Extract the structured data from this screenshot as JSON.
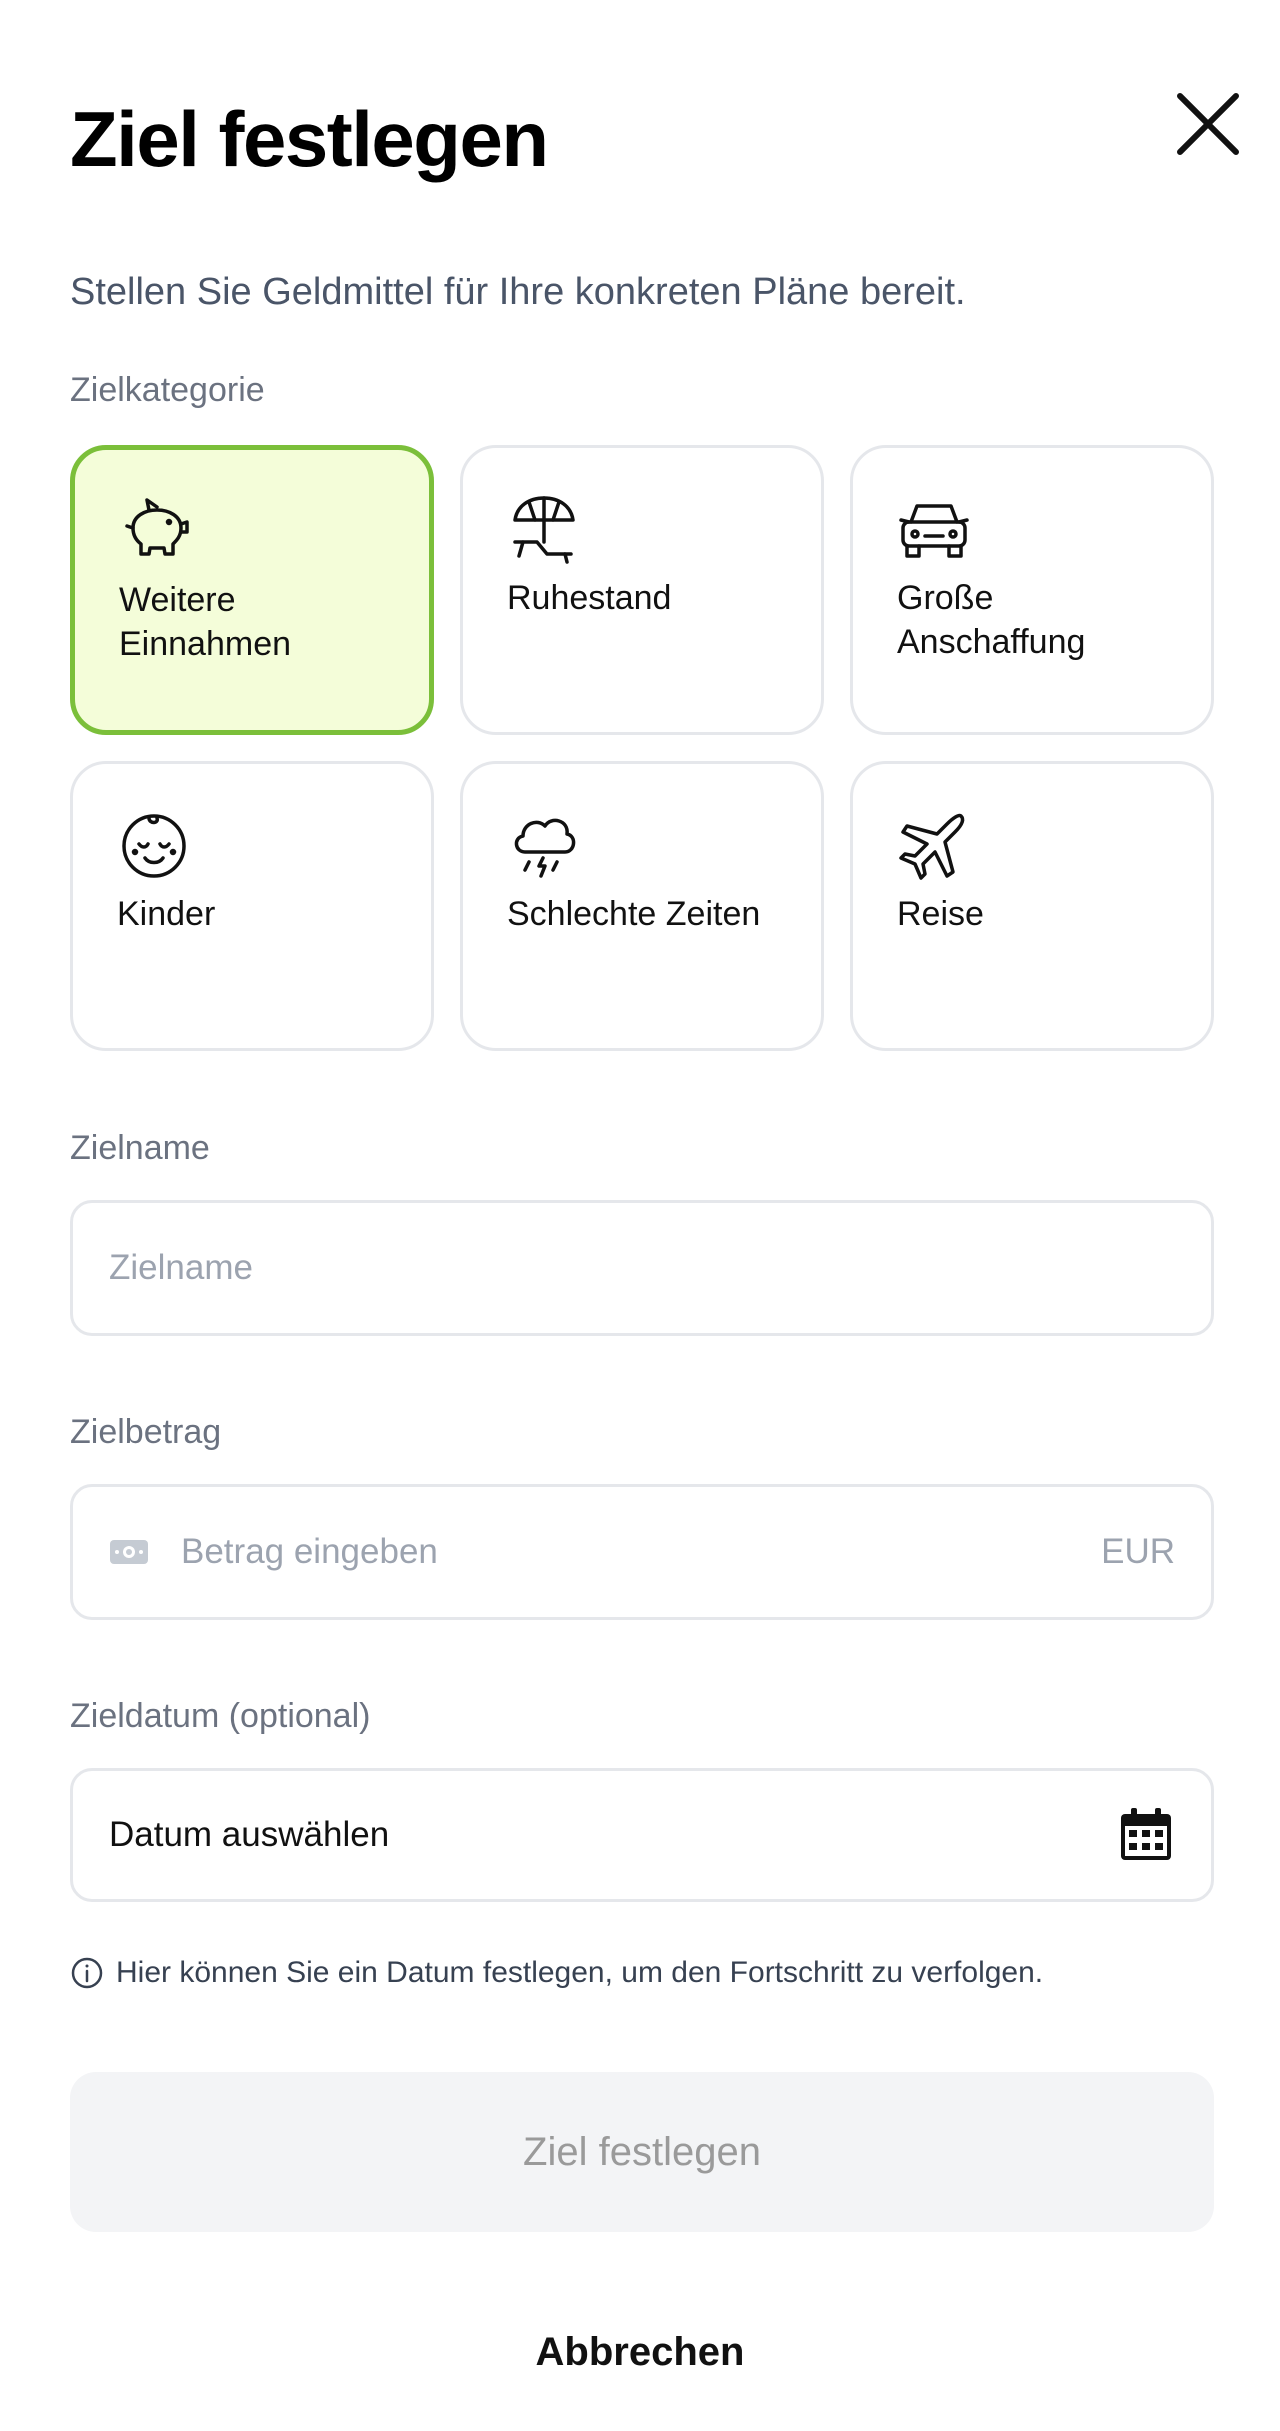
{
  "dialog": {
    "title": "Ziel festlegen",
    "subtitle": "Stellen Sie Geldmittel für Ihre konkreten Pläne bereit.",
    "close_icon": "close-icon"
  },
  "category": {
    "label": "Zielkategorie",
    "selected": "Weitere Einnahmen",
    "items": [
      {
        "label": "Weitere\nEinnahmen",
        "icon": "piggy-bank-icon"
      },
      {
        "label": "Ruhestand",
        "icon": "beach-umbrella-icon"
      },
      {
        "label": "Große\nAnschaffung",
        "icon": "car-icon"
      },
      {
        "label": "Kinder",
        "icon": "baby-face-icon"
      },
      {
        "label": "Schlechte Zeiten",
        "icon": "storm-cloud-icon"
      },
      {
        "label": "Reise",
        "icon": "airplane-icon"
      }
    ]
  },
  "goal_name": {
    "label": "Zielname",
    "placeholder": "Zielname"
  },
  "goal_amount": {
    "label": "Zielbetrag",
    "placeholder": "Betrag eingeben",
    "currency": "EUR",
    "icon": "banknote-icon"
  },
  "goal_date": {
    "label": "Zieldatum (optional)",
    "value": "Datum auswählen",
    "icon": "calendar-icon"
  },
  "hint": {
    "text": "Hier können Sie ein Datum festlegen, um den Fortschritt zu verfolgen.",
    "icon": "info-icon"
  },
  "actions": {
    "submit_label": "Ziel festlegen",
    "cancel_label": "Abbrechen"
  },
  "colors": {
    "selected_bg": "#f4fdd9",
    "selected_border": "#7bbf3a",
    "border": "#e5e7eb",
    "muted_text": "#9ca3af",
    "button_disabled_bg": "#f3f4f6"
  }
}
